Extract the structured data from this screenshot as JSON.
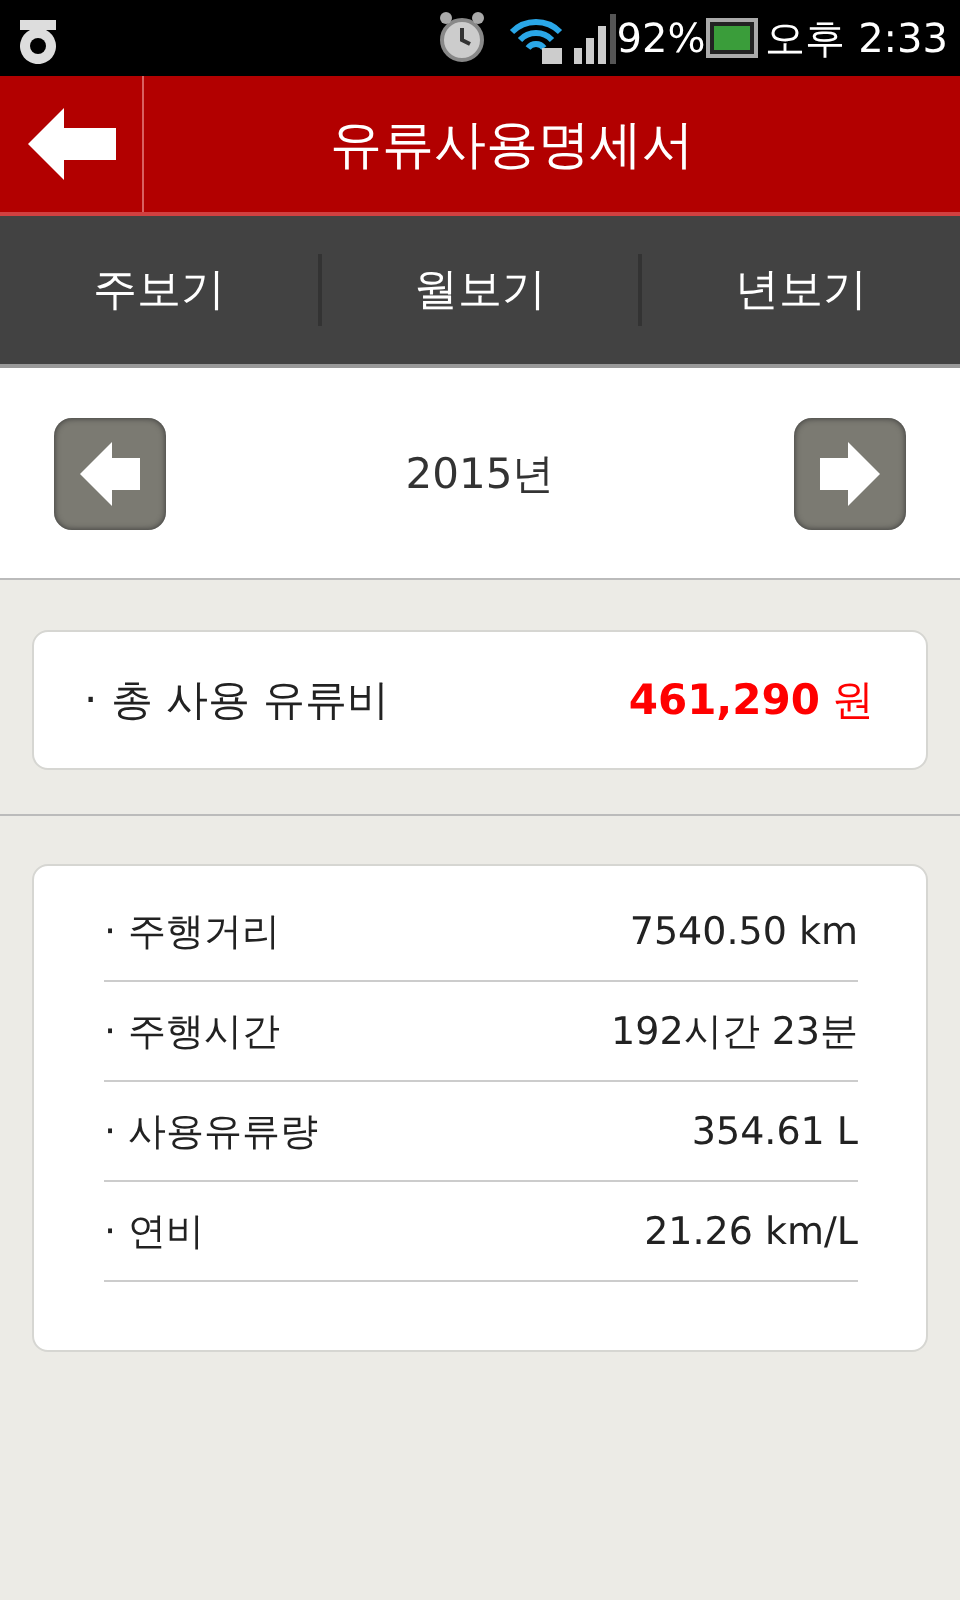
{
  "status_bar": {
    "battery": "92%",
    "time": "오후 2:33"
  },
  "title_bar": {
    "title": "유류사용명세서"
  },
  "tabs": [
    {
      "label": "주보기"
    },
    {
      "label": "월보기"
    },
    {
      "label": "년보기"
    }
  ],
  "period_nav": {
    "label": "2015년"
  },
  "total": {
    "label": "· 총 사용 유류비",
    "amount": "461,290",
    "unit": "원"
  },
  "details": [
    {
      "label": "· 주행거리",
      "value": "7540.50 km"
    },
    {
      "label": "· 주행시간",
      "value": "192시간 23분"
    },
    {
      "label": "· 사용유류량",
      "value": "354.61 L"
    },
    {
      "label": "· 연비",
      "value": "21.26 km/L"
    }
  ]
}
